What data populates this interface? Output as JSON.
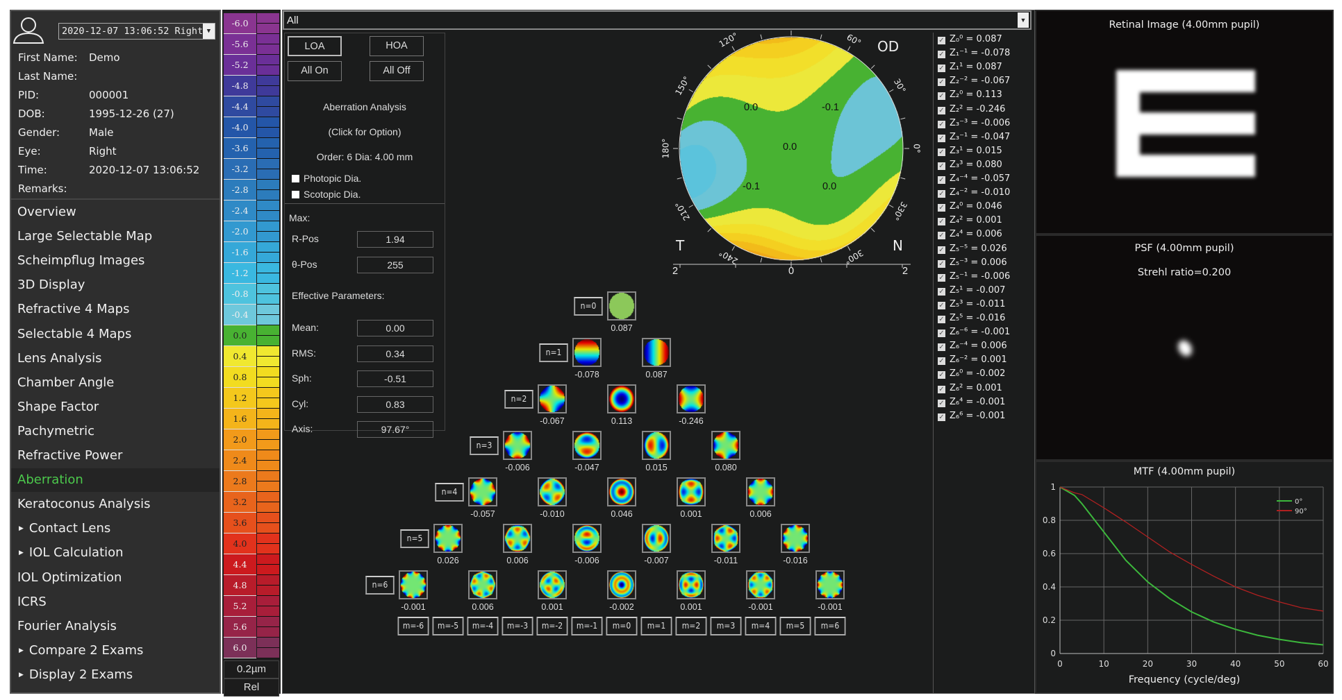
{
  "patient": {
    "exam_select": "2020-12-07 13:06:52 Right",
    "fields": [
      {
        "label": "First Name:",
        "value": "Demo"
      },
      {
        "label": "Last Name:",
        "value": ""
      },
      {
        "label": "PID:",
        "value": "000001"
      },
      {
        "label": "DOB:",
        "value": "1995-12-26  (27)"
      },
      {
        "label": "Gender:",
        "value": "Male"
      },
      {
        "label": "Eye:",
        "value": "Right"
      },
      {
        "label": "Time:",
        "value": "2020-12-07 13:06:52"
      },
      {
        "label": "Remarks:",
        "value": ""
      }
    ]
  },
  "nav": [
    {
      "label": "Overview"
    },
    {
      "label": "Large Selectable Map"
    },
    {
      "label": "Scheimpflug Images"
    },
    {
      "label": "3D Display"
    },
    {
      "label": "Refractive 4 Maps"
    },
    {
      "label": "Selectable 4 Maps"
    },
    {
      "label": "Lens Analysis"
    },
    {
      "label": "Chamber Angle"
    },
    {
      "label": "Shape Factor"
    },
    {
      "label": "Pachymetric"
    },
    {
      "label": "Refractive Power"
    },
    {
      "label": "Aberration",
      "active": true
    },
    {
      "label": "Keratoconus Analysis"
    },
    {
      "label": "Contact Lens",
      "submenu": true
    },
    {
      "label": "IOL Calculation",
      "submenu": true
    },
    {
      "label": "IOL Optimization"
    },
    {
      "label": "ICRS"
    },
    {
      "label": "Fourier Analysis"
    },
    {
      "label": "Compare 2 Exams",
      "submenu": true
    },
    {
      "label": "Display 2 Exams",
      "submenu": true
    }
  ],
  "color_scale": {
    "labels": [
      "-6.0",
      "-5.6",
      "-5.2",
      "-4.8",
      "-4.4",
      "-4.0",
      "-3.6",
      "-3.2",
      "-2.8",
      "-2.4",
      "-2.0",
      "-1.6",
      "-1.2",
      "-0.8",
      "-0.4",
      "0.0",
      "0.4",
      "0.8",
      "1.2",
      "1.6",
      "2.0",
      "2.4",
      "2.8",
      "3.2",
      "3.6",
      "4.0",
      "4.4",
      "4.8",
      "5.2",
      "5.6",
      "6.0"
    ],
    "colors": [
      "#8a3590",
      "#7a3095",
      "#6a2f98",
      "#3f3a9a",
      "#2f4aa0",
      "#2456a8",
      "#2462ae",
      "#2a6db4",
      "#2c7cbc",
      "#2f8ac6",
      "#3299d0",
      "#35a8d8",
      "#3ab8e0",
      "#4ec3de",
      "#6ec8dc",
      "#48b232",
      "#f0e830",
      "#f2dc20",
      "#f4c81c",
      "#f4b41a",
      "#f29a1a",
      "#ef8a1a",
      "#ec7a1c",
      "#e8641c",
      "#e6501c",
      "#e2321c",
      "#cc1a1e",
      "#b81c2a",
      "#a81e3a",
      "#962448",
      "#7c3058"
    ],
    "step": "0.2µm",
    "mode": "Rel"
  },
  "top_select": "All",
  "controls": {
    "loa": "LOA",
    "hoa": "HOA",
    "all_on": "All On",
    "all_off": "All Off",
    "title": "Aberration Analysis",
    "click_hint": "(Click for Option)",
    "order_dia": "Order: 6   Dia: 4.00 mm",
    "photopic": "Photopic Dia.",
    "scotopic": "Scotopic Dia.",
    "max_label": "Max:",
    "r_pos_label": "R-Pos",
    "r_pos": "1.94",
    "theta_pos_label": "θ-Pos",
    "theta_pos": "255",
    "eff_label": "Effective Parameters:",
    "params": [
      {
        "label": "Mean:",
        "value": "0.00"
      },
      {
        "label": "RMS:",
        "value": "0.34"
      },
      {
        "label": "Sph:",
        "value": "-0.51"
      },
      {
        "label": "Cyl:",
        "value": "0.83"
      },
      {
        "label": "Axis:",
        "value": "97.67°"
      }
    ]
  },
  "map": {
    "eye": "OD",
    "temporal": "T",
    "nasal": "N",
    "angle_labels": [
      {
        "deg": 0,
        "text": "0°"
      },
      {
        "deg": 30,
        "text": "30°"
      },
      {
        "deg": 60,
        "text": "60°"
      },
      {
        "deg": 120,
        "text": "120°"
      },
      {
        "deg": 150,
        "text": "150°"
      },
      {
        "deg": 180,
        "text": "180°"
      },
      {
        "deg": 210,
        "text": "210°"
      },
      {
        "deg": 240,
        "text": "240°"
      },
      {
        "deg": 300,
        "text": "300°"
      },
      {
        "deg": 330,
        "text": "330°"
      }
    ],
    "contour_labels": [
      "0.0",
      "-0.1",
      "0.0",
      "-0.1",
      "0.0"
    ],
    "axis_labels": [
      "2",
      "0",
      "2"
    ]
  },
  "zernike": {
    "terms": [
      {
        "n": 0,
        "m": 0,
        "label": "Z₀⁰",
        "value": "0.087"
      },
      {
        "n": 1,
        "m": -1,
        "label": "Z₁⁻¹",
        "value": "-0.078"
      },
      {
        "n": 1,
        "m": 1,
        "label": "Z₁¹",
        "value": "0.087"
      },
      {
        "n": 2,
        "m": -2,
        "label": "Z₂⁻²",
        "value": "-0.067"
      },
      {
        "n": 2,
        "m": 0,
        "label": "Z₂⁰",
        "value": "0.113"
      },
      {
        "n": 2,
        "m": 2,
        "label": "Z₂²",
        "value": "-0.246"
      },
      {
        "n": 3,
        "m": -3,
        "label": "Z₃⁻³",
        "value": "-0.006"
      },
      {
        "n": 3,
        "m": -1,
        "label": "Z₃⁻¹",
        "value": "-0.047"
      },
      {
        "n": 3,
        "m": 1,
        "label": "Z₃¹",
        "value": "0.015"
      },
      {
        "n": 3,
        "m": 3,
        "label": "Z₃³",
        "value": "0.080"
      },
      {
        "n": 4,
        "m": -4,
        "label": "Z₄⁻⁴",
        "value": "-0.057"
      },
      {
        "n": 4,
        "m": -2,
        "label": "Z₄⁻²",
        "value": "-0.010"
      },
      {
        "n": 4,
        "m": 0,
        "label": "Z₄⁰",
        "value": "0.046"
      },
      {
        "n": 4,
        "m": 2,
        "label": "Z₄²",
        "value": "0.001"
      },
      {
        "n": 4,
        "m": 4,
        "label": "Z₄⁴",
        "value": "0.006"
      },
      {
        "n": 5,
        "m": -5,
        "label": "Z₅⁻⁵",
        "value": "0.026"
      },
      {
        "n": 5,
        "m": -3,
        "label": "Z₅⁻³",
        "value": "0.006"
      },
      {
        "n": 5,
        "m": -1,
        "label": "Z₅⁻¹",
        "value": "-0.006"
      },
      {
        "n": 5,
        "m": 1,
        "label": "Z₅¹",
        "value": "-0.007"
      },
      {
        "n": 5,
        "m": 3,
        "label": "Z₅³",
        "value": "-0.011"
      },
      {
        "n": 5,
        "m": 5,
        "label": "Z₅⁵",
        "value": "-0.016"
      },
      {
        "n": 6,
        "m": -6,
        "label": "Z₆⁻⁶",
        "value": "-0.001"
      },
      {
        "n": 6,
        "m": -4,
        "label": "Z₆⁻⁴",
        "value": "0.006"
      },
      {
        "n": 6,
        "m": -2,
        "label": "Z₆⁻²",
        "value": "0.001"
      },
      {
        "n": 6,
        "m": 0,
        "label": "Z₆⁰",
        "value": "-0.002"
      },
      {
        "n": 6,
        "m": 2,
        "label": "Z₆²",
        "value": "0.001"
      },
      {
        "n": 6,
        "m": 4,
        "label": "Z₆⁴",
        "value": "-0.001"
      },
      {
        "n": 6,
        "m": 6,
        "label": "Z₆⁶",
        "value": "-0.001"
      }
    ],
    "n_labels": [
      "n=0",
      "n=1",
      "n=2",
      "n=3",
      "n=4",
      "n=5",
      "n=6"
    ],
    "m_labels": [
      "m=-6",
      "m=-5",
      "m=-4",
      "m=-3",
      "m=-2",
      "m=-1",
      "m=0",
      "m=1",
      "m=2",
      "m=3",
      "m=4",
      "m=5",
      "m=6"
    ]
  },
  "retinal": {
    "title": "Retinal Image (4.00mm pupil)",
    "optotype": "E"
  },
  "psf": {
    "title": "PSF (4.00mm pupil)",
    "strehl": "Strehl ratio=0.200"
  },
  "chart_data": {
    "type": "line",
    "title": "MTF (4.00mm pupil)",
    "xlabel": "Frequency (cycle/deg)",
    "ylabel": "",
    "xlim": [
      0,
      60
    ],
    "ylim": [
      0,
      1
    ],
    "xticks": [
      "0",
      "10",
      "20",
      "30",
      "40",
      "50",
      "60"
    ],
    "yticks": [
      "0",
      "0.2",
      "0.4",
      "0.6",
      "0.8",
      "1"
    ],
    "grid": true,
    "legend": "top-right",
    "x": [
      0,
      3.3,
      5,
      10,
      15,
      20,
      25,
      30,
      35,
      40,
      45,
      50,
      55,
      60
    ],
    "series": [
      {
        "name": "0°",
        "color": "#3cb83c",
        "values": [
          1,
          0.95,
          0.9,
          0.73,
          0.56,
          0.43,
          0.33,
          0.25,
          0.19,
          0.145,
          0.11,
          0.085,
          0.065,
          0.052
        ]
      },
      {
        "name": "90°",
        "color": "#b02020",
        "values": [
          1,
          0.965,
          0.955,
          0.875,
          0.79,
          0.7,
          0.61,
          0.535,
          0.465,
          0.4,
          0.35,
          0.31,
          0.275,
          0.255
        ]
      }
    ]
  }
}
